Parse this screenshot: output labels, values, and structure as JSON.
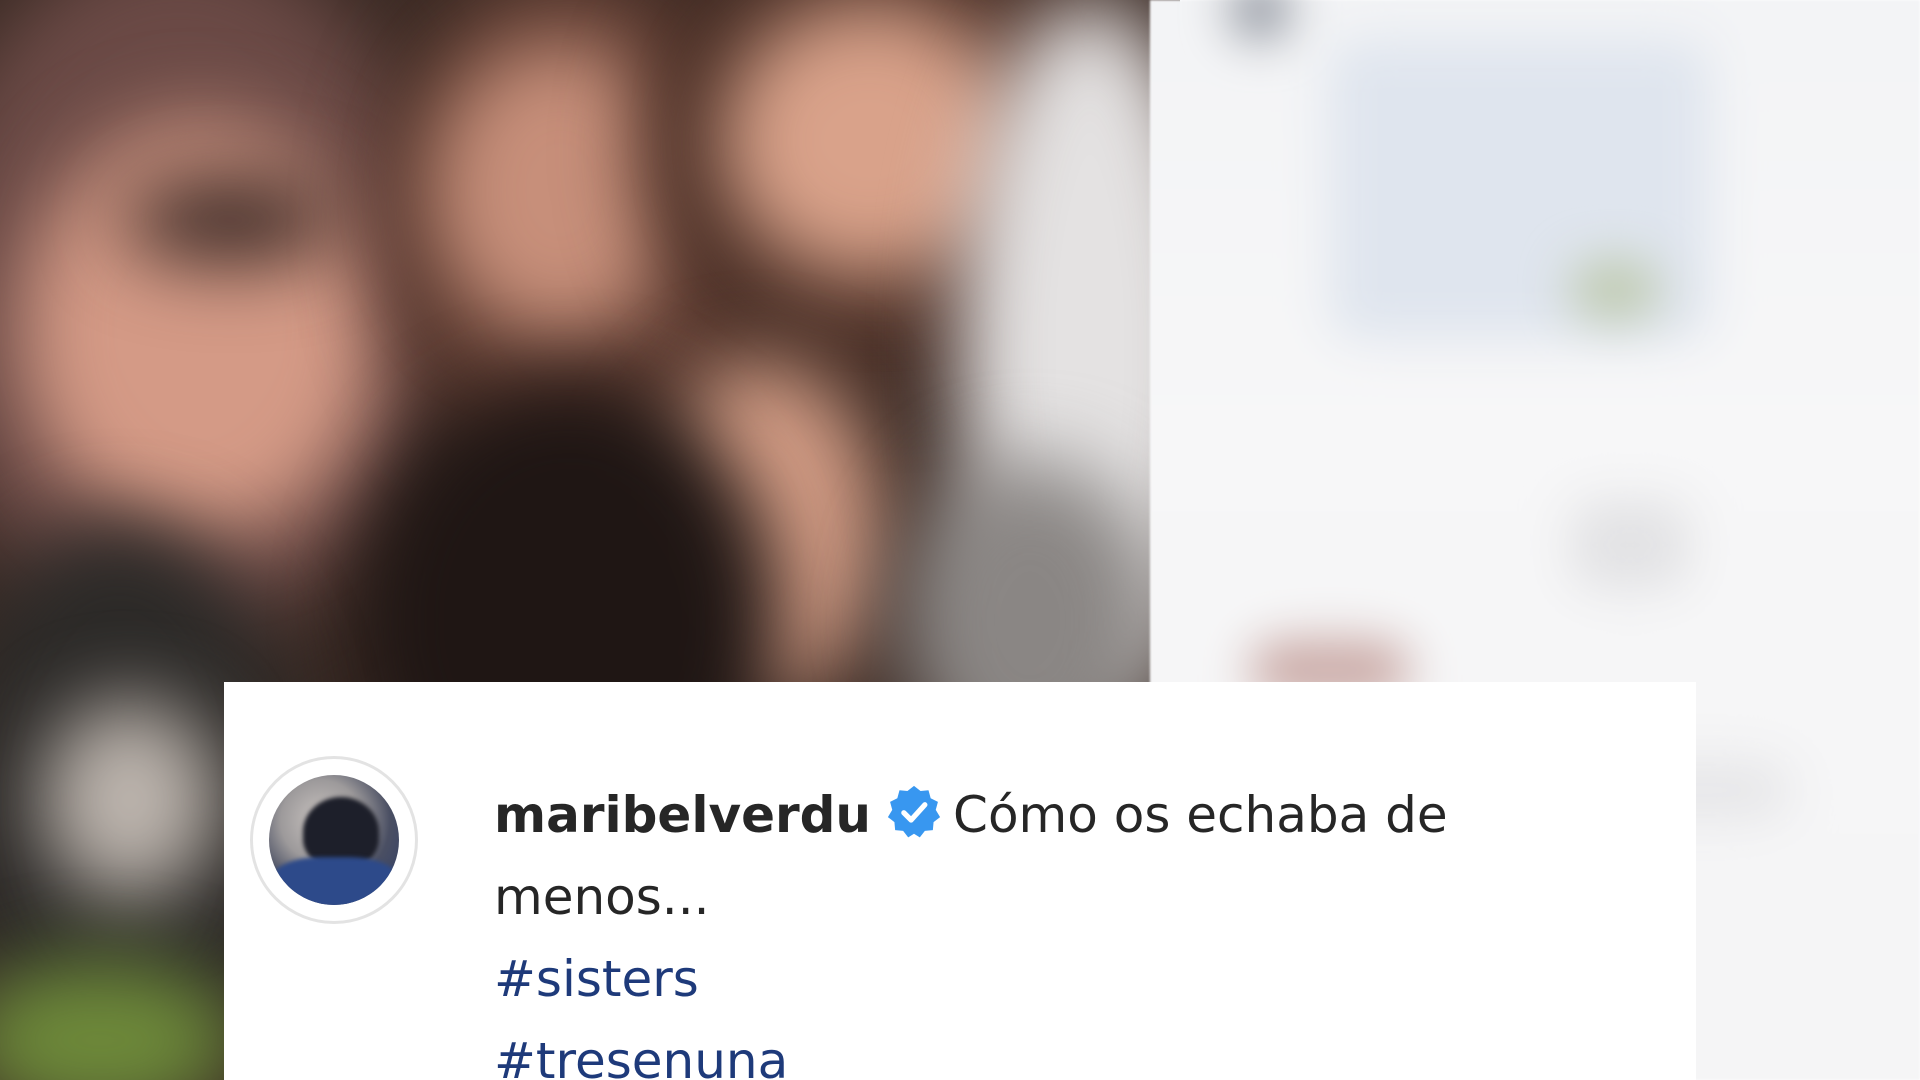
{
  "post": {
    "username": "maribelverdu",
    "verified_badge_icon": "verified-badge-icon",
    "caption_line1": "Cómo os echaba de",
    "caption_line2": "menos...",
    "hashtags": [
      "#sisters",
      "#tresenuna"
    ]
  },
  "colors": {
    "verified_blue": "#3897f0",
    "hashtag": "#1e3a7a",
    "text": "#262626"
  }
}
